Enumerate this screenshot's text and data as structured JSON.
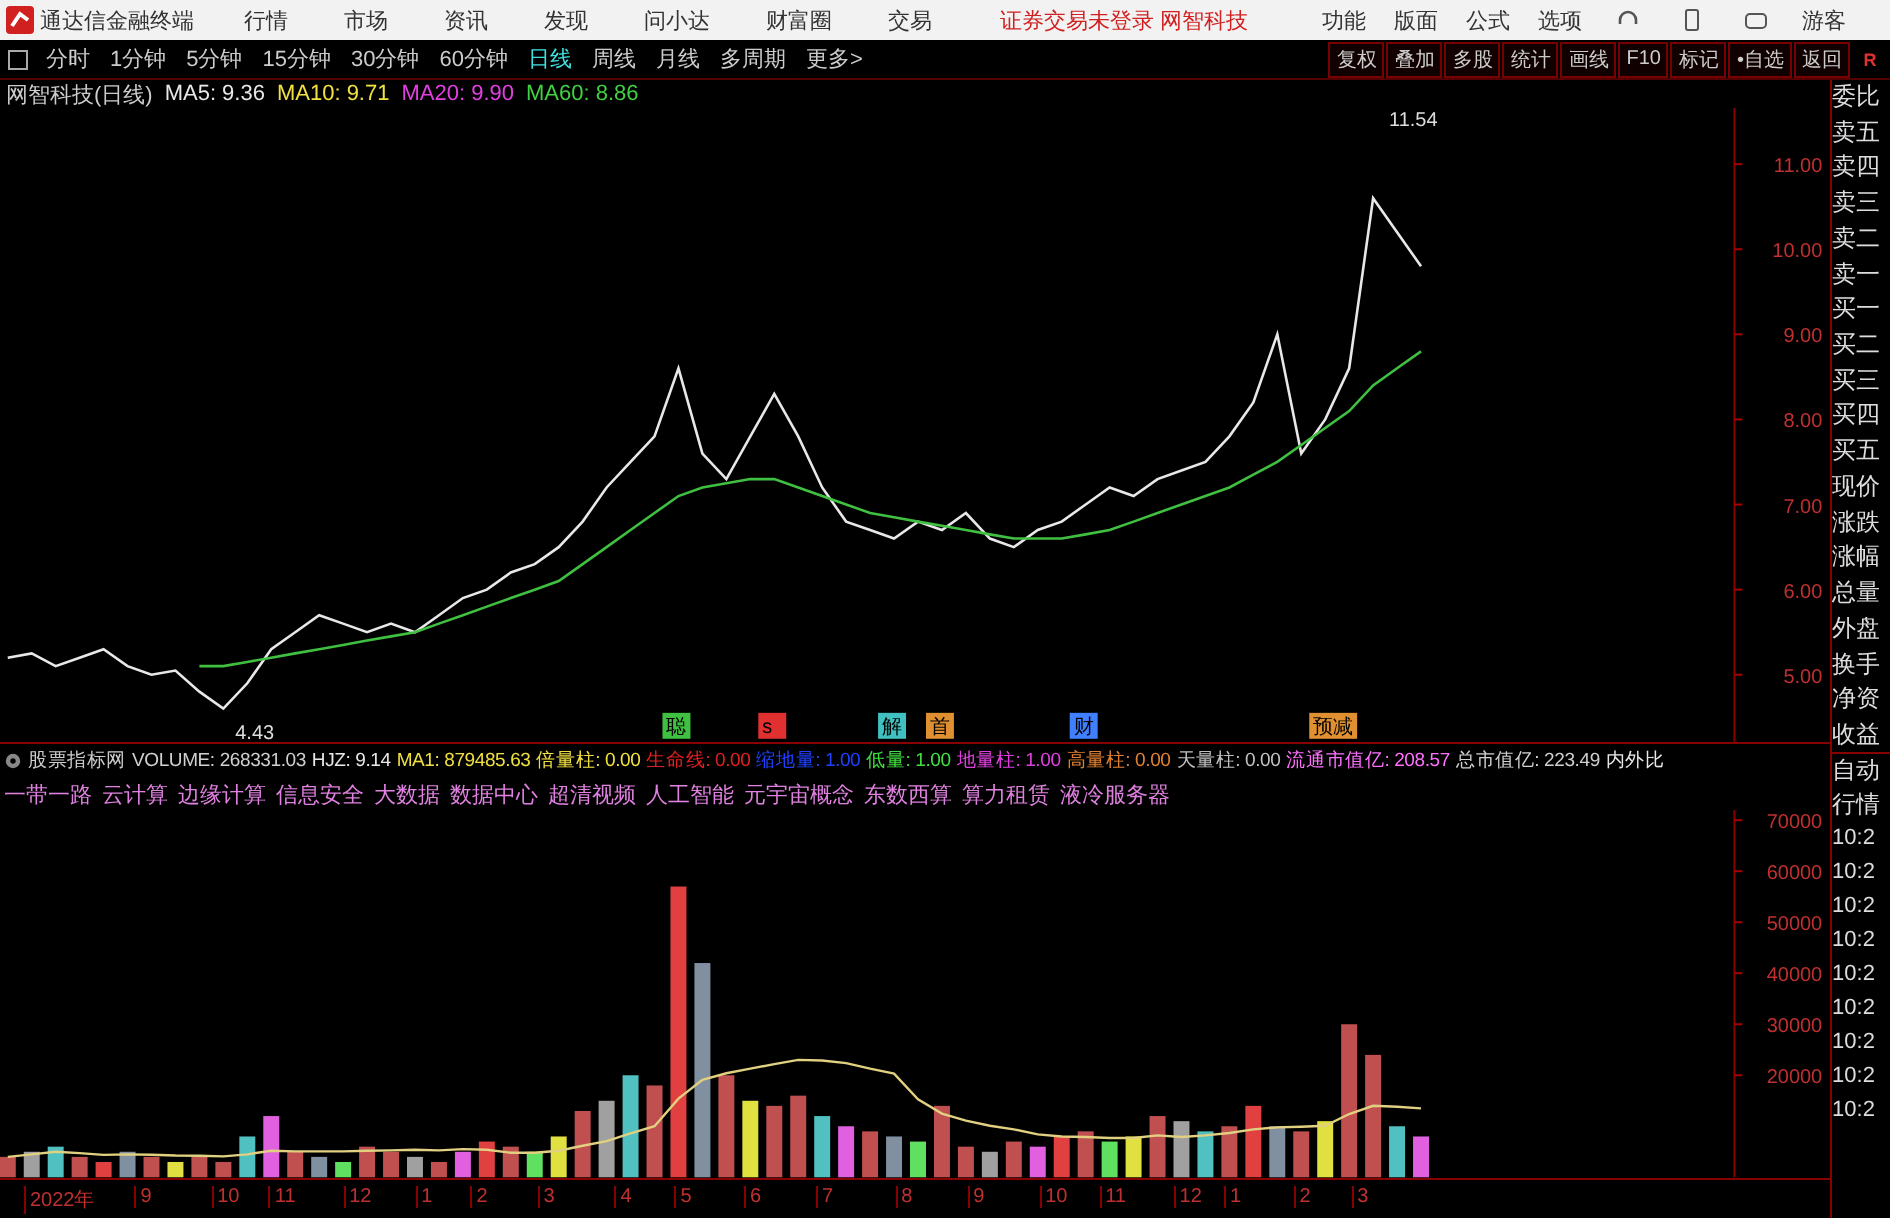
{
  "title_bar": {
    "app_name": "通达信金融终端",
    "menus": [
      "行情",
      "市场",
      "资讯",
      "发现",
      "问小达",
      "财富圈",
      "交易"
    ],
    "notice": "证券交易未登录 网智科技",
    "tools": [
      "功能",
      "版面",
      "公式",
      "选项"
    ],
    "user": "游客"
  },
  "period_tabs": [
    {
      "label": "分时",
      "selected": false
    },
    {
      "label": "1分钟",
      "selected": false
    },
    {
      "label": "5分钟",
      "selected": false
    },
    {
      "label": "15分钟",
      "selected": false
    },
    {
      "label": "30分钟",
      "selected": false
    },
    {
      "label": "60分钟",
      "selected": false
    },
    {
      "label": "日线",
      "selected": true
    },
    {
      "label": "周线",
      "selected": false
    },
    {
      "label": "月线",
      "selected": false
    },
    {
      "label": "多周期",
      "selected": false
    },
    {
      "label": "更多>",
      "selected": false
    }
  ],
  "chart_buttons": [
    "复权",
    "叠加",
    "多股",
    "统计",
    "画线",
    "F10",
    "标记",
    "•自选",
    "返回"
  ],
  "chart_badge": "R",
  "price_panel": {
    "title": "网智科技(日线)",
    "indicators": [
      {
        "label": "MA5: 9.36",
        "color": "#e8e8e8"
      },
      {
        "label": "MA10: 9.71",
        "color": "#f0e040"
      },
      {
        "label": "MA20: 9.90",
        "color": "#e040e0"
      },
      {
        "label": "MA60: 8.86",
        "color": "#40d040"
      }
    ],
    "event_tags": [
      {
        "label": "聪",
        "color": "#40c040"
      },
      {
        "label": "s",
        "color": "#e03030"
      },
      {
        "label": "解",
        "color": "#40c0c0"
      },
      {
        "label": "首",
        "color": "#e09030"
      },
      {
        "label": "财",
        "color": "#4080ff"
      },
      {
        "label": "预减",
        "color": "#e09030"
      }
    ],
    "axis_labels": [
      "11.00",
      "10.00",
      "9.00",
      "8.00",
      "7.00",
      "6.00",
      "5.00"
    ],
    "high_label": "11.54",
    "low_label": "4.43"
  },
  "volume_panel": {
    "title": "股票指标网",
    "readouts": [
      {
        "label": "VOLUME: 268331.03",
        "color": "#d0d0d0"
      },
      {
        "label": "HJZ: 9.14",
        "color": "#e8e8e8"
      },
      {
        "label": "MA1: 879485.63",
        "color": "#f0e040"
      },
      {
        "label": "倍量柱: 0.00",
        "color": "#f0e040"
      },
      {
        "label": "生命线: 0.00",
        "color": "#e02020"
      },
      {
        "label": "缩地量: 1.00",
        "color": "#2040ff"
      },
      {
        "label": "低量: 1.00",
        "color": "#40e040"
      },
      {
        "label": "地量柱: 1.00",
        "color": "#e040e0"
      },
      {
        "label": "高量柱: 0.00",
        "color": "#e08030"
      },
      {
        "label": "天量柱: 0.00",
        "color": "#c0c0c0"
      },
      {
        "label": "流通市值亿: 208.57",
        "color": "#ff70ff"
      },
      {
        "label": "总市值亿: 223.49",
        "color": "#d0d0d0"
      },
      {
        "label": "内外比",
        "color": "#e8e8e8"
      }
    ],
    "concepts": [
      "一带一路",
      "云计算",
      "边缘计算",
      "信息安全",
      "大数据",
      "数据中心",
      "超清视频",
      "人工智能",
      "元宇宙概念",
      "东数西算",
      "算力租赁",
      "液冷服务器"
    ],
    "axis_labels": [
      "70000",
      "60000",
      "50000",
      "40000",
      "30000",
      "20000"
    ],
    "date_labels": [
      "2022年",
      "9",
      "10",
      "11",
      "12",
      "1",
      "2",
      "3",
      "4",
      "5",
      "6",
      "7",
      "8",
      "9",
      "10",
      "11",
      "12",
      "1",
      "2",
      "3"
    ]
  },
  "quote_labels": [
    "委比",
    "卖五",
    "卖四",
    "卖三",
    "卖二",
    "卖一",
    "买一",
    "买二",
    "买三",
    "买四",
    "买五",
    "现价",
    "涨跌",
    "涨幅",
    "总量",
    "外盘",
    "换手",
    "净资",
    "收益"
  ],
  "tick_panel": {
    "title_lines": [
      "自动",
      "行情"
    ],
    "times": [
      "10:2",
      "10:2",
      "10:2",
      "10:2",
      "10:2",
      "10:2",
      "10:2",
      "10:2",
      "10:2"
    ]
  }
}
